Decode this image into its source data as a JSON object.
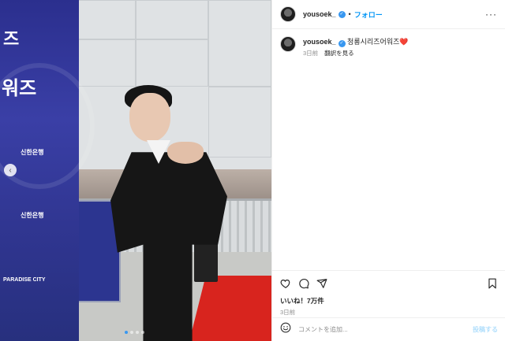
{
  "header": {
    "username": "yousoek_",
    "separator": "•",
    "follow_label": "フォロー",
    "more_label": "···"
  },
  "caption": {
    "username": "yousoek_",
    "text": "청룡시리즈어워즈❤️",
    "time": "3日前",
    "translate_label": "翻訳を見る"
  },
  "banner": {
    "text_a": "즈",
    "text_b": "워즈",
    "sponsor": "신한은행",
    "sponsor2": "PARADISE CITY"
  },
  "actions": {
    "likes": "いいね！7万件",
    "date": "3日前"
  },
  "comment": {
    "placeholder": "コメントを追加...",
    "post_label": "投稿する"
  },
  "carousel": {
    "total": 4,
    "active_index": 1
  },
  "colors": {
    "accent": "#0095f6",
    "banner": "#2b2f8e",
    "carpet": "#d8241e"
  }
}
